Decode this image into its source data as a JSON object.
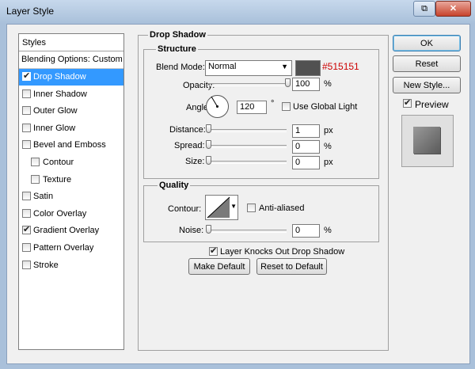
{
  "window": {
    "title": "Layer Style",
    "help_glyph": "⧉",
    "close_glyph": "✕"
  },
  "styles_list": {
    "header": "Styles",
    "blending_options": "Blending Options: Custom",
    "items": [
      {
        "label": "Drop Shadow",
        "checked": true,
        "selected": true
      },
      {
        "label": "Inner Shadow",
        "checked": false
      },
      {
        "label": "Outer Glow",
        "checked": false
      },
      {
        "label": "Inner Glow",
        "checked": false
      },
      {
        "label": "Bevel and Emboss",
        "checked": false
      },
      {
        "label": "Contour",
        "checked": false,
        "indent": true
      },
      {
        "label": "Texture",
        "checked": false,
        "indent": true
      },
      {
        "label": "Satin",
        "checked": false
      },
      {
        "label": "Color Overlay",
        "checked": false
      },
      {
        "label": "Gradient Overlay",
        "checked": true
      },
      {
        "label": "Pattern Overlay",
        "checked": false
      },
      {
        "label": "Stroke",
        "checked": false
      }
    ]
  },
  "drop_shadow": {
    "title": "Drop Shadow",
    "structure": {
      "title": "Structure",
      "blend_mode_label": "Blend Mode:",
      "blend_mode_value": "Normal",
      "color_hex": "#515151",
      "opacity_label": "Opacity:",
      "opacity_value": "100",
      "opacity_unit": "%",
      "opacity_level": 1.0,
      "angle_label": "Angle:",
      "angle_value": "120",
      "angle_unit": "°",
      "use_global_light": "Use Global Light",
      "distance_label": "Distance:",
      "distance_value": "1",
      "distance_unit": "px",
      "spread_label": "Spread:",
      "spread_value": "0",
      "spread_unit": "%",
      "size_label": "Size:",
      "size_value": "0",
      "size_unit": "px"
    },
    "quality": {
      "title": "Quality",
      "contour_label": "Contour:",
      "anti_aliased": "Anti-aliased",
      "noise_label": "Noise:",
      "noise_value": "0",
      "noise_unit": "%"
    },
    "layer_knocks_out": "Layer Knocks Out Drop Shadow",
    "make_default": "Make Default",
    "reset_default": "Reset to Default"
  },
  "actions": {
    "ok": "OK",
    "reset": "Reset",
    "new_style": "New Style...",
    "preview": "Preview"
  },
  "colors": {
    "shadow": "#515151",
    "selection": "#3399ff",
    "hex_text": "#cc0000"
  }
}
